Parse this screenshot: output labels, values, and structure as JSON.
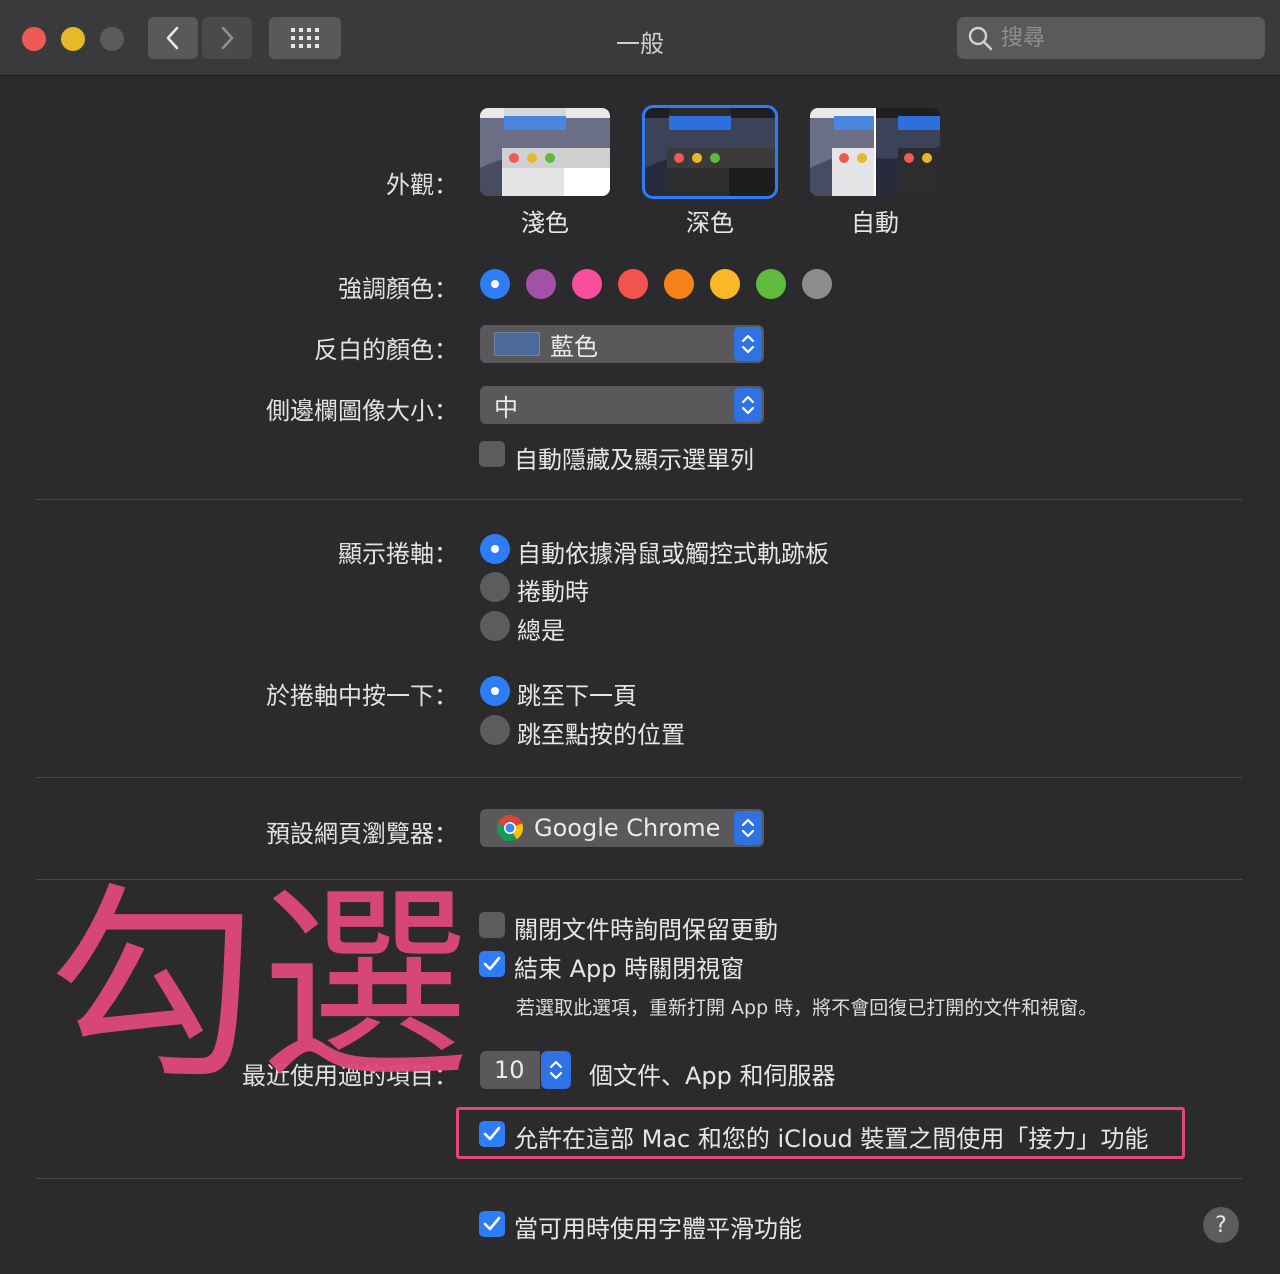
{
  "window": {
    "title": "一般",
    "search_placeholder": "搜尋"
  },
  "appearance": {
    "label": "外觀：",
    "options": [
      "淺色",
      "深色",
      "自動"
    ],
    "selected": "深色"
  },
  "accent": {
    "label": "強調顏色：",
    "colors": [
      "#2e7cf6",
      "#a550a7",
      "#f74f9e",
      "#f2534e",
      "#f7821b",
      "#fbb826",
      "#5ebb3b",
      "#8c8c8c"
    ],
    "selected_index": 0
  },
  "highlight_color": {
    "label": "反白的顏色：",
    "value": "藍色",
    "swatch": "#4b6a9a"
  },
  "sidebar_icon_size": {
    "label": "側邊欄圖像大小：",
    "value": "中"
  },
  "menubar": {
    "auto_hide_label": "自動隱藏及顯示選單列",
    "auto_hide_checked": false
  },
  "scrollbars": {
    "label": "顯示捲軸：",
    "options": [
      "自動依據滑鼠或觸控式軌跡板",
      "捲動時",
      "總是"
    ],
    "selected_index": 0
  },
  "click_scrollbar": {
    "label": "於捲軸中按一下：",
    "options": [
      "跳至下一頁",
      "跳至點按的位置"
    ],
    "selected_index": 0
  },
  "browser": {
    "label": "預設網頁瀏覽器：",
    "value": "Google Chrome"
  },
  "documents": {
    "ask_keep_changes_label": "關閉文件時詢問保留更動",
    "ask_keep_changes_checked": false,
    "close_windows_label": "結束 App 時關閉視窗",
    "close_windows_checked": true,
    "close_windows_note": "若選取此選項，重新打開 App 時，將不會回復已打開的文件和視窗。"
  },
  "recent_items": {
    "label": "最近使用過的項目：",
    "value": "10",
    "suffix": "個文件、App 和伺服器"
  },
  "handoff": {
    "label": "允許在這部 Mac 和您的 iCloud 裝置之間使用「接力」功能",
    "checked": true
  },
  "font_smoothing": {
    "label": "當可用時使用字體平滑功能",
    "checked": true
  },
  "annotation": {
    "overlay_text": "勾選",
    "color": "#e0457b"
  },
  "help": {
    "label": "?"
  }
}
